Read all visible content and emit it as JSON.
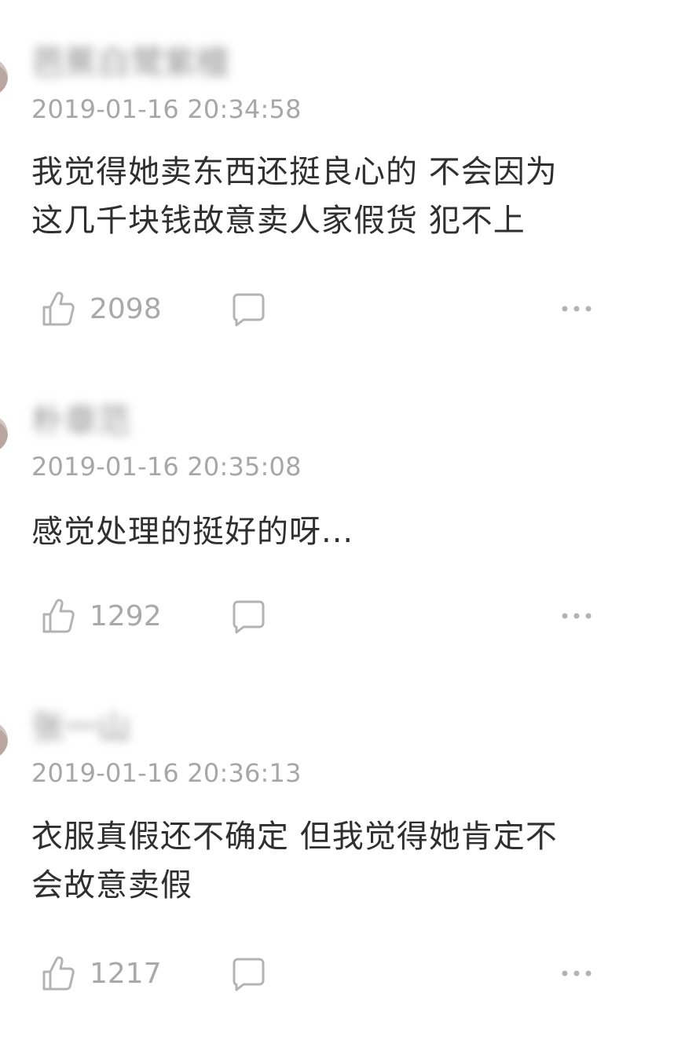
{
  "comments": [
    {
      "username": "芭蕉白鹭紫檀",
      "timestamp": "2019-01-16 20:34:58",
      "text_lines": [
        "我觉得她卖东西还挺良心的 不会因为",
        "这几千块钱故意卖人家假货 犯不上"
      ],
      "likes": "2098",
      "icons": {
        "like": "thumbs-up-icon",
        "reply": "comment-bubble-icon",
        "more": "more-dots-icon"
      }
    },
    {
      "username": "朴章范",
      "timestamp": "2019-01-16 20:35:08",
      "text_lines": [
        "感觉处理的挺好的呀..."
      ],
      "likes": "1292",
      "icons": {
        "like": "thumbs-up-icon",
        "reply": "comment-bubble-icon",
        "more": "more-dots-icon"
      }
    },
    {
      "username": "张一山",
      "timestamp": "2019-01-16 20:36:13",
      "text_lines": [
        "衣服真假还不确定 但我觉得她肯定不",
        "会故意卖假"
      ],
      "likes": "1217",
      "icons": {
        "like": "thumbs-up-icon",
        "reply": "comment-bubble-icon",
        "more": "more-dots-icon"
      }
    }
  ],
  "colors": {
    "background": "#ffffff",
    "text": "#2f2f2f",
    "meta": "#a7a7a7",
    "icon": "#b3b3b3"
  }
}
